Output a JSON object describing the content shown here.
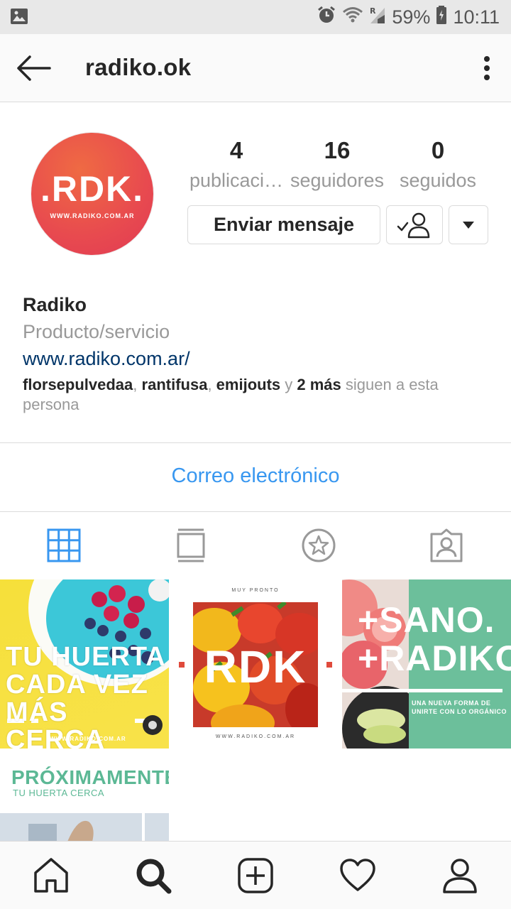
{
  "status_bar": {
    "battery": "59%",
    "time": "10:11"
  },
  "app_bar": {
    "title": "radiko.ok"
  },
  "profile": {
    "avatar_text": ".RDK.",
    "avatar_subtext": "WWW.RADIKO.COM.AR",
    "stats": [
      {
        "value": "4",
        "label": "publicaci…"
      },
      {
        "value": "16",
        "label": "seguidores"
      },
      {
        "value": "0",
        "label": "seguidos"
      }
    ],
    "message_button": "Enviar mensaje",
    "name": "Radiko",
    "category": "Producto/servicio",
    "website": "www.radiko.com.ar/",
    "followed_by": {
      "users": [
        "florsepulvedaa",
        "rantifusa",
        "emijouts"
      ],
      "connector": "y",
      "more": "2 más",
      "suffix": "siguen a esta persona"
    },
    "email_label": "Correo electrónico"
  },
  "posts": {
    "post1": {
      "lines": [
        "TU HUERTA",
        "CADA VEZ",
        "MÁS CERCA"
      ],
      "footer": "WWW.RADIKO.COM.AR"
    },
    "post2": {
      "top": "MUY PRONTO",
      "main": "RDK",
      "footer": "WWW.RADIKO.COM.AR"
    },
    "post3": {
      "line1": "+SANO.",
      "line2": "+RADIKO.",
      "sub1": "UNA NUEVA FORMA DE",
      "sub2": "UNIRTE CON LO ORGÁNICO"
    },
    "post4": {
      "title": "PRÓXIMAMENTE",
      "sub": "TU HUERTA CERCA"
    }
  },
  "colors": {
    "accent": "#3897f0",
    "link": "#003569",
    "avatar": "#e84a4f",
    "green": "#6cbf9b"
  },
  "icons": {
    "tabs": [
      "grid-icon",
      "feed-icon",
      "star-icon",
      "tagged-icon"
    ],
    "nav": [
      "home-icon",
      "search-icon",
      "add-icon",
      "heart-icon",
      "profile-icon"
    ]
  }
}
